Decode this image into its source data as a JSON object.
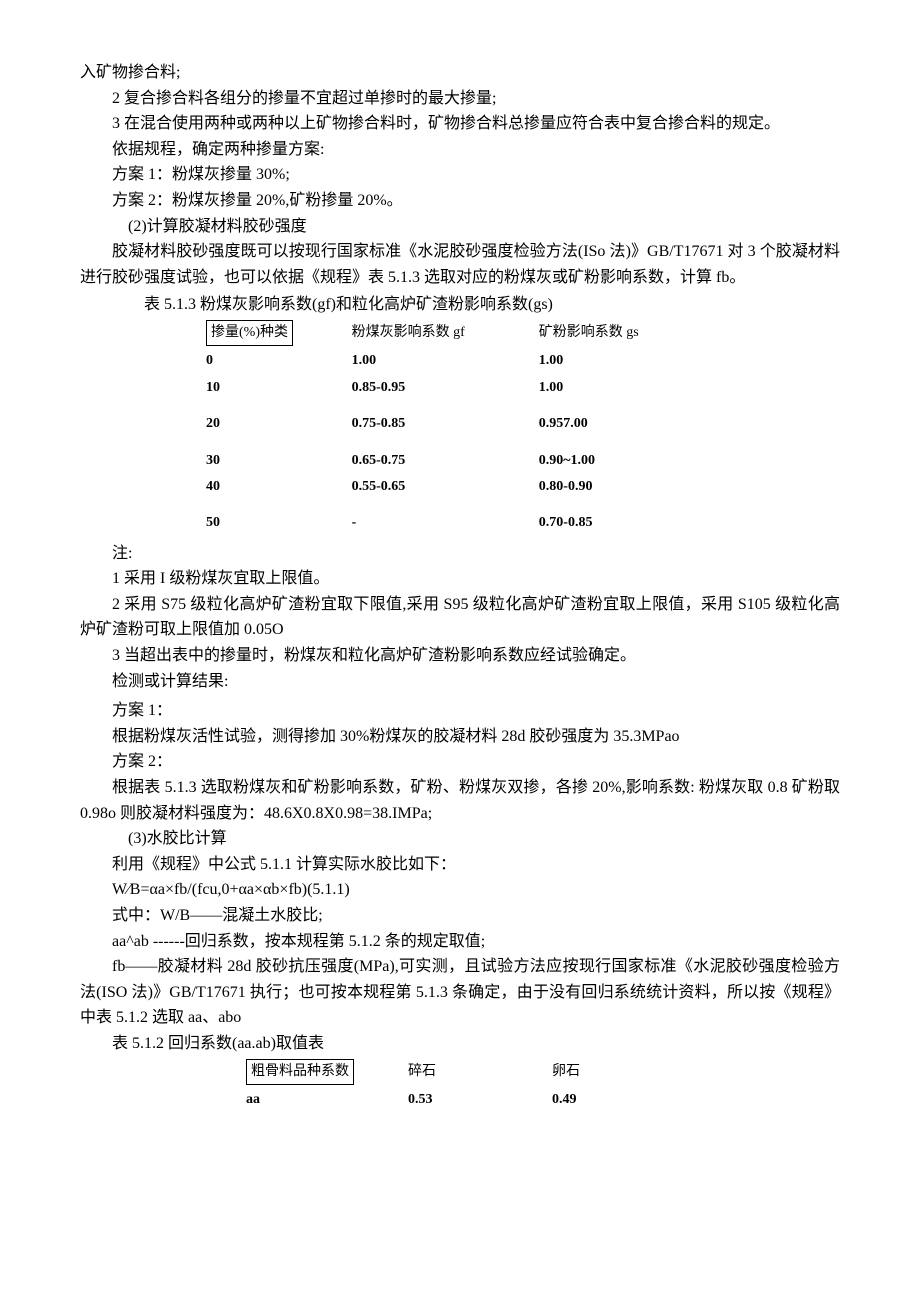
{
  "p": [
    "入矿物掺合料;",
    "2 复合掺合料各组分的掺量不宜超过单掺时的最大掺量;",
    "3 在混合使用两种或两种以上矿物掺合料时，矿物掺合料总掺量应符合表中复合掺合料的规定。",
    "依据规程，确定两种掺量方案:",
    "方案 1：粉煤灰掺量 30%;",
    "方案 2：粉煤灰掺量 20%,矿粉掺量 20%。",
    "(2)计算胶凝材料胶砂强度",
    "胶凝材料胶砂强度既可以按现行国家标准《水泥胶砂强度检验方法(ISo 法)》GB/T17671 对 3 个胶凝材料进行胶砂强度试验，也可以依据《规程》表 5.1.3 选取对应的粉煤灰或矿粉影响系数，计算 fb。",
    "表 5.1.3 粉煤灰影响系数(gf)和粒化高炉矿渣粉影响系数(gs)",
    "注:",
    "1 采用 I 级粉煤灰宜取上限值。",
    "2 采用 S75 级粒化高炉矿渣粉宜取下限值,采用 S95 级粒化高炉矿渣粉宜取上限值，采用 S105 级粒化高炉矿渣粉可取上限值加 0.05O",
    "3 当超出表中的掺量时，粉煤灰和粒化高炉矿渣粉影响系数应经试验确定。",
    "检测或计算结果:",
    "方案 1：",
    "根据粉煤灰活性试验，测得掺加 30%粉煤灰的胶凝材料 28d 胶砂强度为 35.3MPao",
    "方案 2：",
    "根据表 5.1.3 选取粉煤灰和矿粉影响系数，矿粉、粉煤灰双掺，各掺 20%,影响系数: 粉煤灰取 0.8 矿粉取 0.98o 则胶凝材料强度为：48.6X0.8X0.98=38.IMPa;",
    "(3)水胶比计算",
    "利用《规程》中公式 5.1.1 计算实际水胶比如下：",
    "W∕B=αa×fb/(fcu,0+αa×αb×fb)(5.1.1)",
    "式中：W/B——混凝土水胶比;",
    "aa^ab ------回归系数，按本规程第 5.1.2 条的规定取值;",
    "fb——胶凝材料 28d 胶砂抗压强度(MPa),可实测，且试验方法应按现行国家标准《水泥胶砂强度检验方法(ISO 法)》GB/T17671 执行；也可按本规程第 5.1.3 条确定，由于没有回归系统统计资料，所以按《规程》中表 5.1.2 选取 aa、abo",
    "表 5.1.2 回归系数(aa.ab)取值表"
  ],
  "t1": {
    "headers": [
      "掺量(%)种类",
      "粉煤灰影响系数 gf",
      "矿粉影响系数 gs"
    ],
    "rows": [
      [
        "0",
        "1.00",
        "1.00"
      ],
      [
        "10",
        "0.85-0.95",
        "1.00"
      ],
      [
        "20",
        "0.75-0.85",
        "0.957.00"
      ],
      [
        "30",
        "0.65-0.75",
        "0.90~1.00"
      ],
      [
        "40",
        "0.55-0.65",
        "0.80-0.90"
      ],
      [
        "50",
        "-",
        "0.70-0.85"
      ]
    ]
  },
  "t2": {
    "headers": [
      "粗骨料品种系数",
      "碎石",
      "卵石"
    ],
    "rows": [
      [
        "aa",
        "0.53",
        "0.49"
      ]
    ]
  }
}
